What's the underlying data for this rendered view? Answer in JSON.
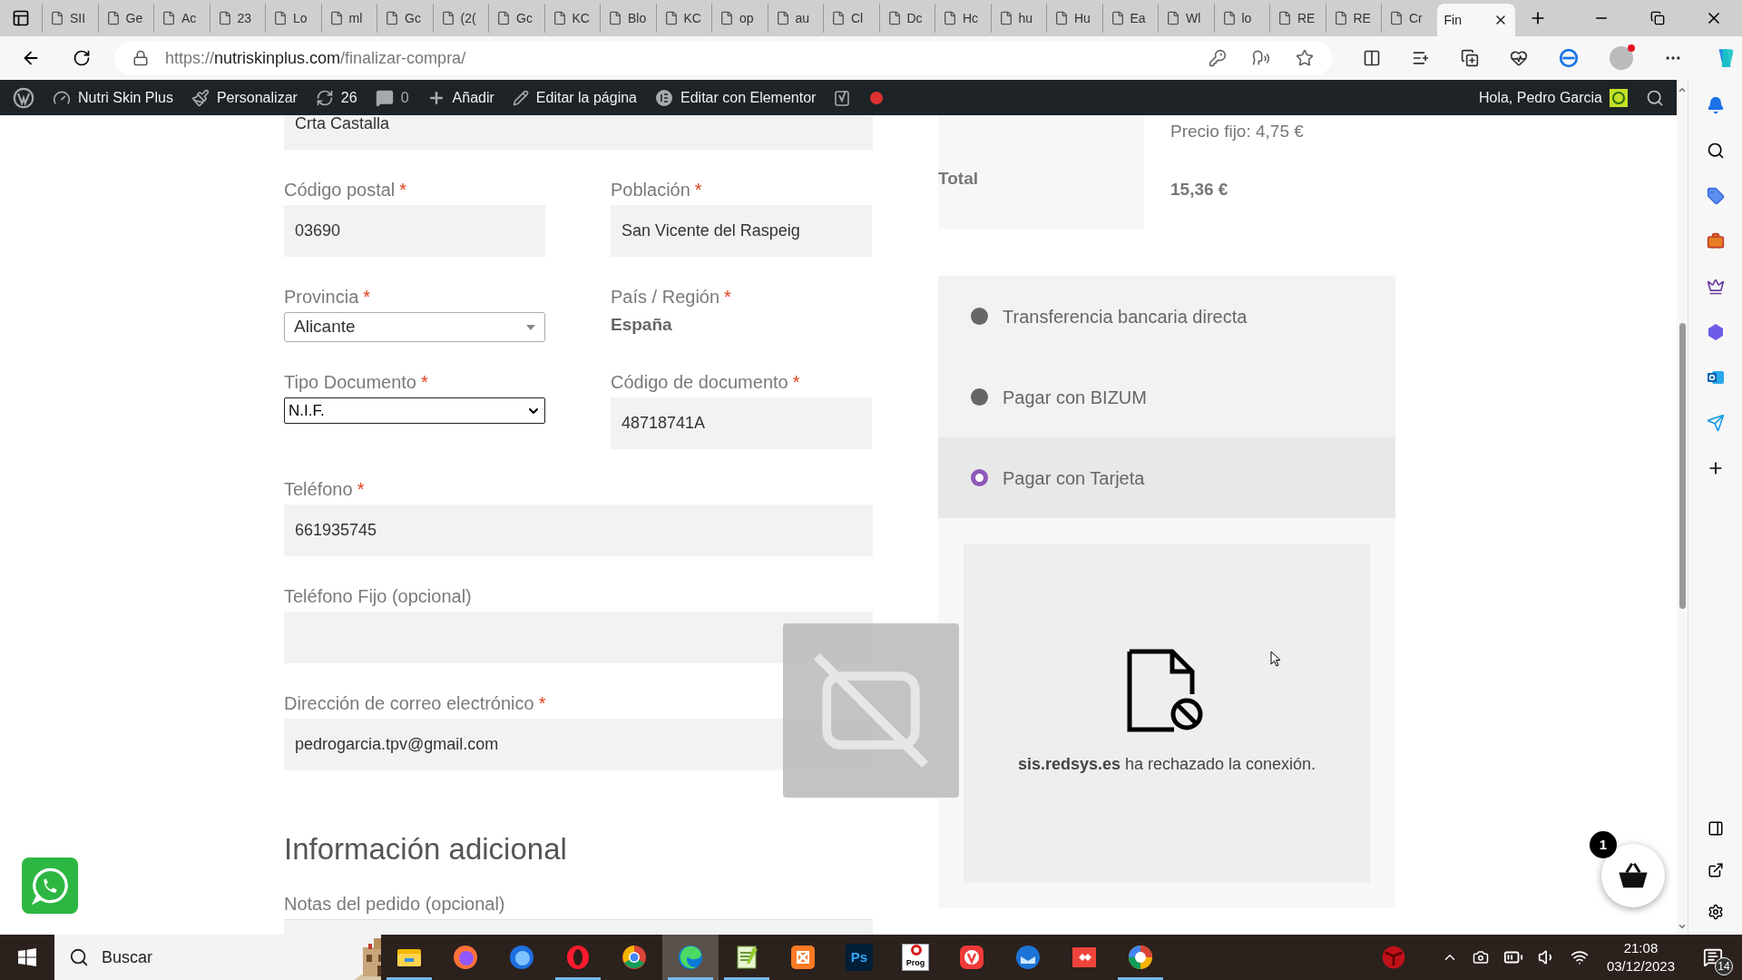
{
  "browser": {
    "tabs": [
      {
        "title": "SII",
        "selected": false
      },
      {
        "title": "Ge",
        "selected": false
      },
      {
        "title": "Ac",
        "selected": false
      },
      {
        "title": "23",
        "selected": false
      },
      {
        "title": "Lo",
        "selected": false
      },
      {
        "title": "ml",
        "selected": false
      },
      {
        "title": "Gc",
        "selected": false
      },
      {
        "title": "(2(",
        "selected": false
      },
      {
        "title": "Gc",
        "selected": false
      },
      {
        "title": "KC",
        "selected": false
      },
      {
        "title": "Blo",
        "selected": false
      },
      {
        "title": "KC",
        "selected": false
      },
      {
        "title": "op",
        "selected": false
      },
      {
        "title": "au",
        "selected": false
      },
      {
        "title": "Cl",
        "selected": false
      },
      {
        "title": "Dc",
        "selected": false
      },
      {
        "title": "Hc",
        "selected": false
      },
      {
        "title": "hu",
        "selected": false
      },
      {
        "title": "Hu",
        "selected": false
      },
      {
        "title": "Ea",
        "selected": false
      },
      {
        "title": "Wl",
        "selected": false
      },
      {
        "title": "lo",
        "selected": false
      },
      {
        "title": "RE",
        "selected": false
      },
      {
        "title": "RE",
        "selected": false
      },
      {
        "title": "Cr",
        "selected": false
      },
      {
        "title": "Fin",
        "selected": true
      }
    ],
    "url_scheme": "https://",
    "url_host": "nutriskinplus.com",
    "url_path": "/finalizar-compra/"
  },
  "admin_bar": {
    "site_name": "Nutri Skin Plus",
    "customize": "Personalizar",
    "updates": "26",
    "comments": "0",
    "add_new": "Añadir",
    "edit_page": "Editar la página",
    "edit_elementor": "Editar con Elementor",
    "greeting": "Hola, Pedro Garcia"
  },
  "checkout": {
    "rows": [
      {
        "kind": "fields",
        "fields": [
          {
            "kind": "text",
            "value": "Crta Castalla"
          }
        ]
      },
      {
        "kind": "fields",
        "fields": [
          {
            "kind": "text",
            "label": "Código postal",
            "mark": "*",
            "value": "03690"
          },
          {
            "kind": "text",
            "label": "Población",
            "mark": "*",
            "value": "San Vicente del Raspeig"
          }
        ]
      },
      {
        "kind": "fields",
        "fields": [
          {
            "kind": "select",
            "label": "Provincia",
            "mark": "*",
            "value": "Alicante"
          },
          {
            "kind": "static",
            "label": "País / Región",
            "mark": "*",
            "value": "España"
          }
        ]
      },
      {
        "kind": "fields",
        "fields": [
          {
            "kind": "native_select",
            "label": "Tipo Documento",
            "mark": "*",
            "value": "N.I.F."
          },
          {
            "kind": "text",
            "label": "Código de documento",
            "mark": "*",
            "value": "48718741A"
          }
        ]
      },
      {
        "kind": "fields",
        "fields": [
          {
            "kind": "text",
            "label": "Teléfono",
            "mark": "*",
            "value": "661935745"
          }
        ]
      },
      {
        "kind": "fields",
        "fields": [
          {
            "kind": "text",
            "label": "Teléfono Fijo (opcional)"
          }
        ]
      },
      {
        "kind": "fields",
        "fields": [
          {
            "kind": "text",
            "label": "Dirección de correo electrónico",
            "mark": "*",
            "value": "pedrogarcia.tpv@gmail.com"
          }
        ]
      },
      {
        "kind": "heading",
        "text": "Información adicional"
      },
      {
        "kind": "fields",
        "fields": [
          {
            "kind": "textarea",
            "label": "Notas del pedido (opcional)"
          }
        ]
      }
    ]
  },
  "order": {
    "shipping_value": "Precio fijo: 4,75 €",
    "total_label": "Total",
    "total_value": "15,36 €"
  },
  "payment": {
    "methods": [
      {
        "label": "Transferencia bancaria directa",
        "selected": false
      },
      {
        "label": "Pagar con BIZUM",
        "selected": false
      },
      {
        "label": "Pagar con Tarjeta",
        "selected": true
      }
    ],
    "frame_message": "**sis.redsys.es** ha rechazado la conexión."
  },
  "cart": {
    "count": "1"
  },
  "taskbar": {
    "search_placeholder": "Buscar",
    "apps": [
      {
        "kind": "explorer",
        "open": true,
        "selected": false
      },
      {
        "kind": "firefox",
        "open": false,
        "selected": false
      },
      {
        "kind": "firefox_dev",
        "open": false,
        "selected": false
      },
      {
        "kind": "opera",
        "open": true,
        "selected": false
      },
      {
        "kind": "chrome",
        "open": false,
        "selected": false
      },
      {
        "kind": "edge",
        "open": true,
        "selected": true
      },
      {
        "kind": "notepad",
        "open": true,
        "selected": false
      },
      {
        "kind": "xampp",
        "open": false,
        "selected": false
      },
      {
        "kind": "photoshop",
        "label": "Ps",
        "open": false,
        "selected": false
      },
      {
        "kind": "prog",
        "label": "Prog",
        "open": false,
        "selected": false
      },
      {
        "kind": "vivaldi",
        "open": false,
        "selected": false
      },
      {
        "kind": "thunderbird",
        "open": false,
        "selected": false
      },
      {
        "kind": "anydesk",
        "open": false,
        "selected": false
      },
      {
        "kind": "picasa",
        "open": true,
        "selected": false
      }
    ],
    "time": "21:08",
    "date": "03/12/2023",
    "notifications": "14"
  }
}
